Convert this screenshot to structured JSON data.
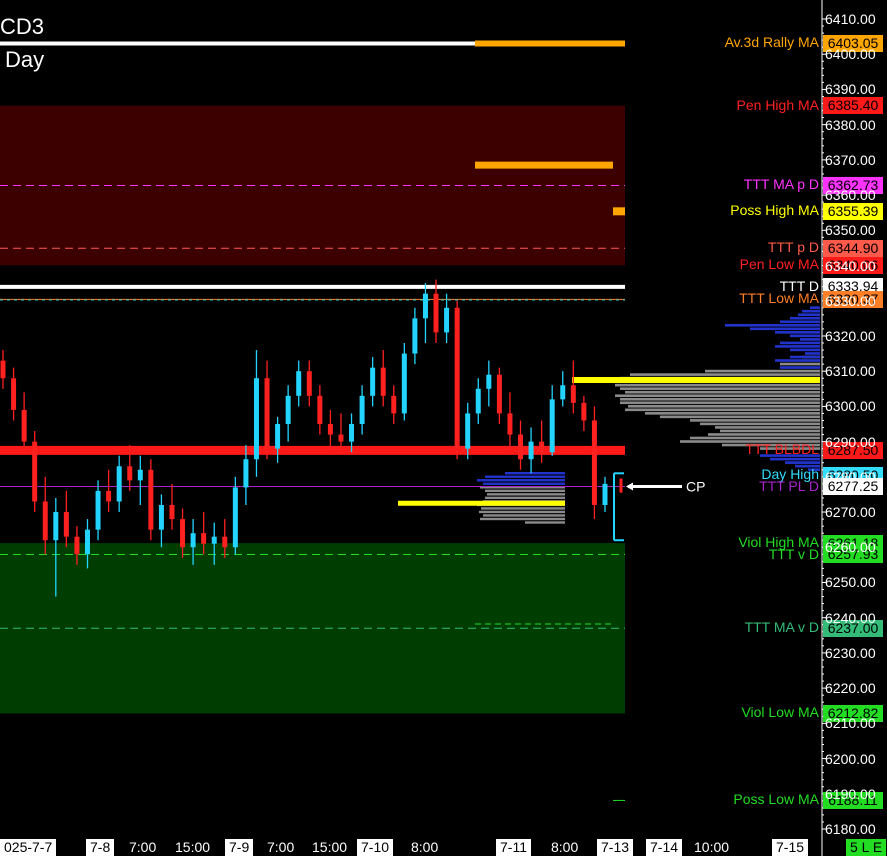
{
  "title": "CD3",
  "subtitle": "Day",
  "chart_data": {
    "type": "candlestick",
    "ylim": [
      6180,
      6410
    ],
    "y_ticks": [
      "6410.00",
      "6400.00",
      "6390.00",
      "6380.00",
      "6370.00",
      "6360.00",
      "6350.00",
      "6340.00",
      "6330.00",
      "6320.00",
      "6310.00",
      "6300.00",
      "6290.00",
      "6280.00",
      "6270.00",
      "6260.00",
      "6250.00",
      "6240.00",
      "6230.00",
      "6220.00",
      "6210.00",
      "6200.00",
      "6190.00",
      "6180.00"
    ],
    "x_ticks": [
      {
        "label": "025-7-7",
        "hl": true
      },
      {
        "label": "7-8",
        "hl": true
      },
      {
        "label": "7:00",
        "hl": false
      },
      {
        "label": "15:00",
        "hl": false
      },
      {
        "label": "7-9",
        "hl": true
      },
      {
        "label": "7:00",
        "hl": false
      },
      {
        "label": "15:00",
        "hl": false
      },
      {
        "label": "7-10",
        "hl": true
      },
      {
        "label": "8:00",
        "hl": false
      },
      {
        "label": "7-11",
        "hl": true
      },
      {
        "label": "8:00",
        "hl": false
      },
      {
        "label": "7-13",
        "hl": true
      },
      {
        "label": "7-14",
        "hl": true
      },
      {
        "label": "10:00",
        "hl": false
      },
      {
        "label": "7-15",
        "hl": true
      },
      {
        "label": "5 L E",
        "hl": true
      }
    ],
    "zones": [
      {
        "name": "resistance-zone",
        "from": 6385.4,
        "to": 6340.06,
        "color": "#3d0000"
      },
      {
        "name": "support-zone",
        "from": 6261.18,
        "to": 6212.82,
        "color": "#003d00"
      }
    ],
    "levels": [
      {
        "label": "Av.3d Rally MA",
        "value": 6403.05,
        "text_color": "#ffa500",
        "box_color": "#ffa500",
        "box_text": "#000000"
      },
      {
        "label": "Pen High MA",
        "value": 6385.4,
        "text_color": "#ff2020",
        "box_color": "#ff1a1a",
        "box_text": "#000000"
      },
      {
        "label": "TTT MA p D",
        "value": 6362.73,
        "text_color": "#ff33ff",
        "box_color": "#ff33ff",
        "box_text": "#000000"
      },
      {
        "label": "Poss High MA",
        "value": 6355.39,
        "text_color": "#ffff00",
        "box_color": "#ffff00",
        "box_text": "#000000"
      },
      {
        "label": "TTT p D",
        "value": 6344.9,
        "text_color": "#ff5a4a",
        "box_color": "#ff5a4a",
        "box_text": "#000000"
      },
      {
        "label": "Pen Low MA",
        "value": 6340.06,
        "text_color": "#ff2020",
        "box_color": "#ff1a1a",
        "box_text": "#000000"
      },
      {
        "label": "TTT D",
        "value": 6333.94,
        "text_color": "#ffffff",
        "box_color": "#ffffff",
        "box_text": "#000000"
      },
      {
        "label": "TTT Low MA",
        "value": 6330.37,
        "text_color": "#ff7f27",
        "box_color": "#ff7f27",
        "box_text": "#000000"
      },
      {
        "label": "TTT BLBDL",
        "value": 6287.5,
        "text_color": "#ff2020",
        "box_color": "#ff1a1a",
        "box_text": "#000000"
      },
      {
        "label": "Day High",
        "value": 6280.5,
        "text_color": "#33ddff",
        "box_color": "#33ddff",
        "box_text": "#000000"
      },
      {
        "label": "TTT PL D",
        "value": 6277.25,
        "text_color": "#aa22cc",
        "box_color": "#ffffff",
        "box_text": "#000000"
      },
      {
        "label": "Viol High MA",
        "value": 6261.18,
        "text_color": "#22dd22",
        "box_color": "#22dd22",
        "box_text": "#000000"
      },
      {
        "label": "TTT v D",
        "value": 6257.93,
        "text_color": "#22dd22",
        "box_color": "#22dd22",
        "box_text": "#000000"
      },
      {
        "label": "TTT MA v D",
        "value": 6237.0,
        "text_color": "#33bb77",
        "box_color": "#33bb77",
        "box_text": "#000000"
      },
      {
        "label": "Viol Low MA",
        "value": 6212.82,
        "text_color": "#22dd22",
        "box_color": "#22dd22",
        "box_text": "#000000"
      },
      {
        "label": "Poss Low MA",
        "value": 6188.11,
        "text_color": "#22dd22",
        "box_color": "#22dd22",
        "box_text": "#000000"
      }
    ],
    "cp_label": "CP",
    "candles": [
      [
        6313,
        6316,
        6305,
        6308
      ],
      [
        6308,
        6311,
        6296,
        6299
      ],
      [
        6299,
        6304,
        6287,
        6290
      ],
      [
        6290,
        6293,
        6270,
        6273
      ],
      [
        6273,
        6280,
        6258,
        6262
      ],
      [
        6262,
        6274,
        6246,
        6270
      ],
      [
        6270,
        6276,
        6260,
        6263
      ],
      [
        6263,
        6266,
        6255,
        6258
      ],
      [
        6258,
        6268,
        6254,
        6265
      ],
      [
        6265,
        6279,
        6262,
        6276
      ],
      [
        6276,
        6282,
        6270,
        6273
      ],
      [
        6273,
        6286,
        6270,
        6283
      ],
      [
        6283,
        6289,
        6276,
        6279
      ],
      [
        6279,
        6286,
        6272,
        6282
      ],
      [
        6282,
        6285,
        6262,
        6265
      ],
      [
        6265,
        6275,
        6260,
        6272
      ],
      [
        6272,
        6278,
        6265,
        6268
      ],
      [
        6268,
        6271,
        6257,
        6260
      ],
      [
        6260,
        6268,
        6255,
        6264
      ],
      [
        6264,
        6270,
        6258,
        6261
      ],
      [
        6261,
        6267,
        6255,
        6263
      ],
      [
        6263,
        6268,
        6257,
        6260
      ],
      [
        6260,
        6280,
        6258,
        6277
      ],
      [
        6277,
        6289,
        6272,
        6285
      ],
      [
        6285,
        6316,
        6280,
        6308
      ],
      [
        6308,
        6313,
        6285,
        6288
      ],
      [
        6288,
        6297,
        6284,
        6295
      ],
      [
        6295,
        6306,
        6290,
        6303
      ],
      [
        6303,
        6313,
        6300,
        6310
      ],
      [
        6310,
        6313,
        6300,
        6303
      ],
      [
        6303,
        6306,
        6292,
        6295
      ],
      [
        6295,
        6299,
        6288,
        6292
      ],
      [
        6292,
        6298,
        6287,
        6290
      ],
      [
        6290,
        6298,
        6287,
        6295
      ],
      [
        6295,
        6306,
        6292,
        6303
      ],
      [
        6303,
        6314,
        6300,
        6311
      ],
      [
        6311,
        6316,
        6300,
        6303
      ],
      [
        6303,
        6306,
        6295,
        6298
      ],
      [
        6298,
        6318,
        6296,
        6315
      ],
      [
        6315,
        6328,
        6312,
        6325
      ],
      [
        6325,
        6335,
        6318,
        6332
      ],
      [
        6332,
        6336,
        6318,
        6321
      ],
      [
        6321,
        6332,
        6318,
        6328
      ],
      [
        6328,
        6330,
        6285,
        6288
      ],
      [
        6288,
        6301,
        6285,
        6298
      ],
      [
        6298,
        6308,
        6295,
        6305
      ],
      [
        6305,
        6313,
        6300,
        6309
      ],
      [
        6309,
        6311,
        6295,
        6298
      ],
      [
        6298,
        6304,
        6288,
        6292
      ],
      [
        6292,
        6296,
        6282,
        6285
      ],
      [
        6285,
        6294,
        6281,
        6290
      ],
      [
        6290,
        6296,
        6284,
        6287
      ],
      [
        6287,
        6306,
        6286,
        6302
      ],
      [
        6302,
        6310,
        6300,
        6306
      ],
      [
        6306,
        6313,
        6298,
        6301
      ],
      [
        6301,
        6303,
        6293,
        6296
      ],
      [
        6296,
        6300,
        6268,
        6272
      ],
      [
        6272,
        6280,
        6270,
        6278
      ]
    ]
  }
}
